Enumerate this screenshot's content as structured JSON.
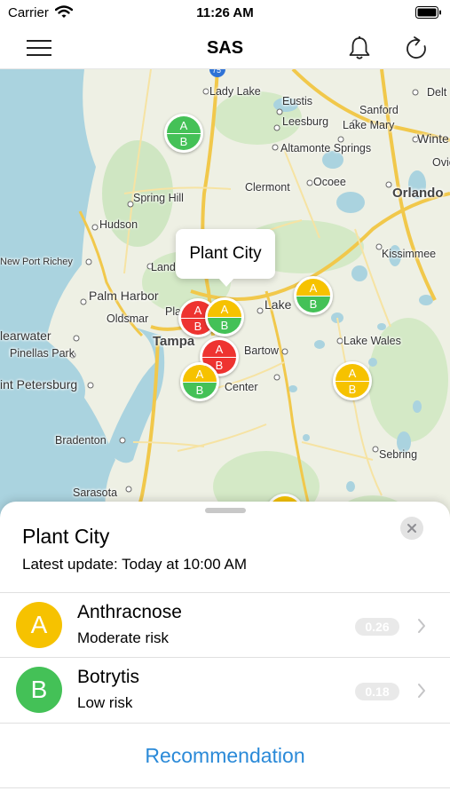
{
  "status_bar": {
    "carrier": "Carrier",
    "time": "11:26 AM"
  },
  "nav": {
    "title": "SAS",
    "menu_icon": "hamburger-menu-icon",
    "bell_icon": "bell-icon",
    "refresh_icon": "refresh-icon"
  },
  "map": {
    "places": {
      "lady_lake": "Lady Lake",
      "eustis": "Eustis",
      "leesburg": "Leesburg",
      "sanford": "Sanford",
      "lake_mary": "Lake Mary",
      "altamonte": "Altamonte Springs",
      "clermont": "Clermont",
      "ocoee": "Ocoee",
      "orlando": "Orlando",
      "spring_hill": "Spring Hill",
      "hudson": "Hudson",
      "new_port_richey": "New Port Richey",
      "kissimmee": "Kissimmee",
      "land": "Land",
      "palm_harbor": "Palm Harbor",
      "oldsmar": "Oldsmar",
      "pla": "Pla",
      "lake": "Lake",
      "clearwater": "learwater",
      "tampa": "Tampa",
      "pinellas": "Pinellas Park",
      "bartow": "Bartow",
      "lake_wales": "Lake Wales",
      "st_pete": "int Petersburg",
      "center": "Center",
      "bradenton": "Bradenton",
      "sebring": "Sebring",
      "sarasota": "Sarasota",
      "delt": "Delt",
      "winte": "Winte",
      "ovie": "Ovie",
      "highway": "75"
    },
    "marker_letters": {
      "a": "A",
      "b": "B"
    },
    "colors": {
      "red": "#ee3330",
      "yellow": "#f6c200",
      "green": "#44c157"
    },
    "callout": "Plant City"
  },
  "sheet": {
    "title": "Plant City",
    "subtitle": "Latest update: Today at 10:00 AM",
    "close_icon": "close-icon",
    "diseases": [
      {
        "letter": "A",
        "name": "Anthracnose",
        "risk": "Moderate risk",
        "value": "0.26",
        "color": "#f6c200"
      },
      {
        "letter": "B",
        "name": "Botrytis",
        "risk": "Low risk",
        "value": "0.18",
        "color": "#44c157"
      }
    ],
    "recommendation": "Recommendation"
  }
}
